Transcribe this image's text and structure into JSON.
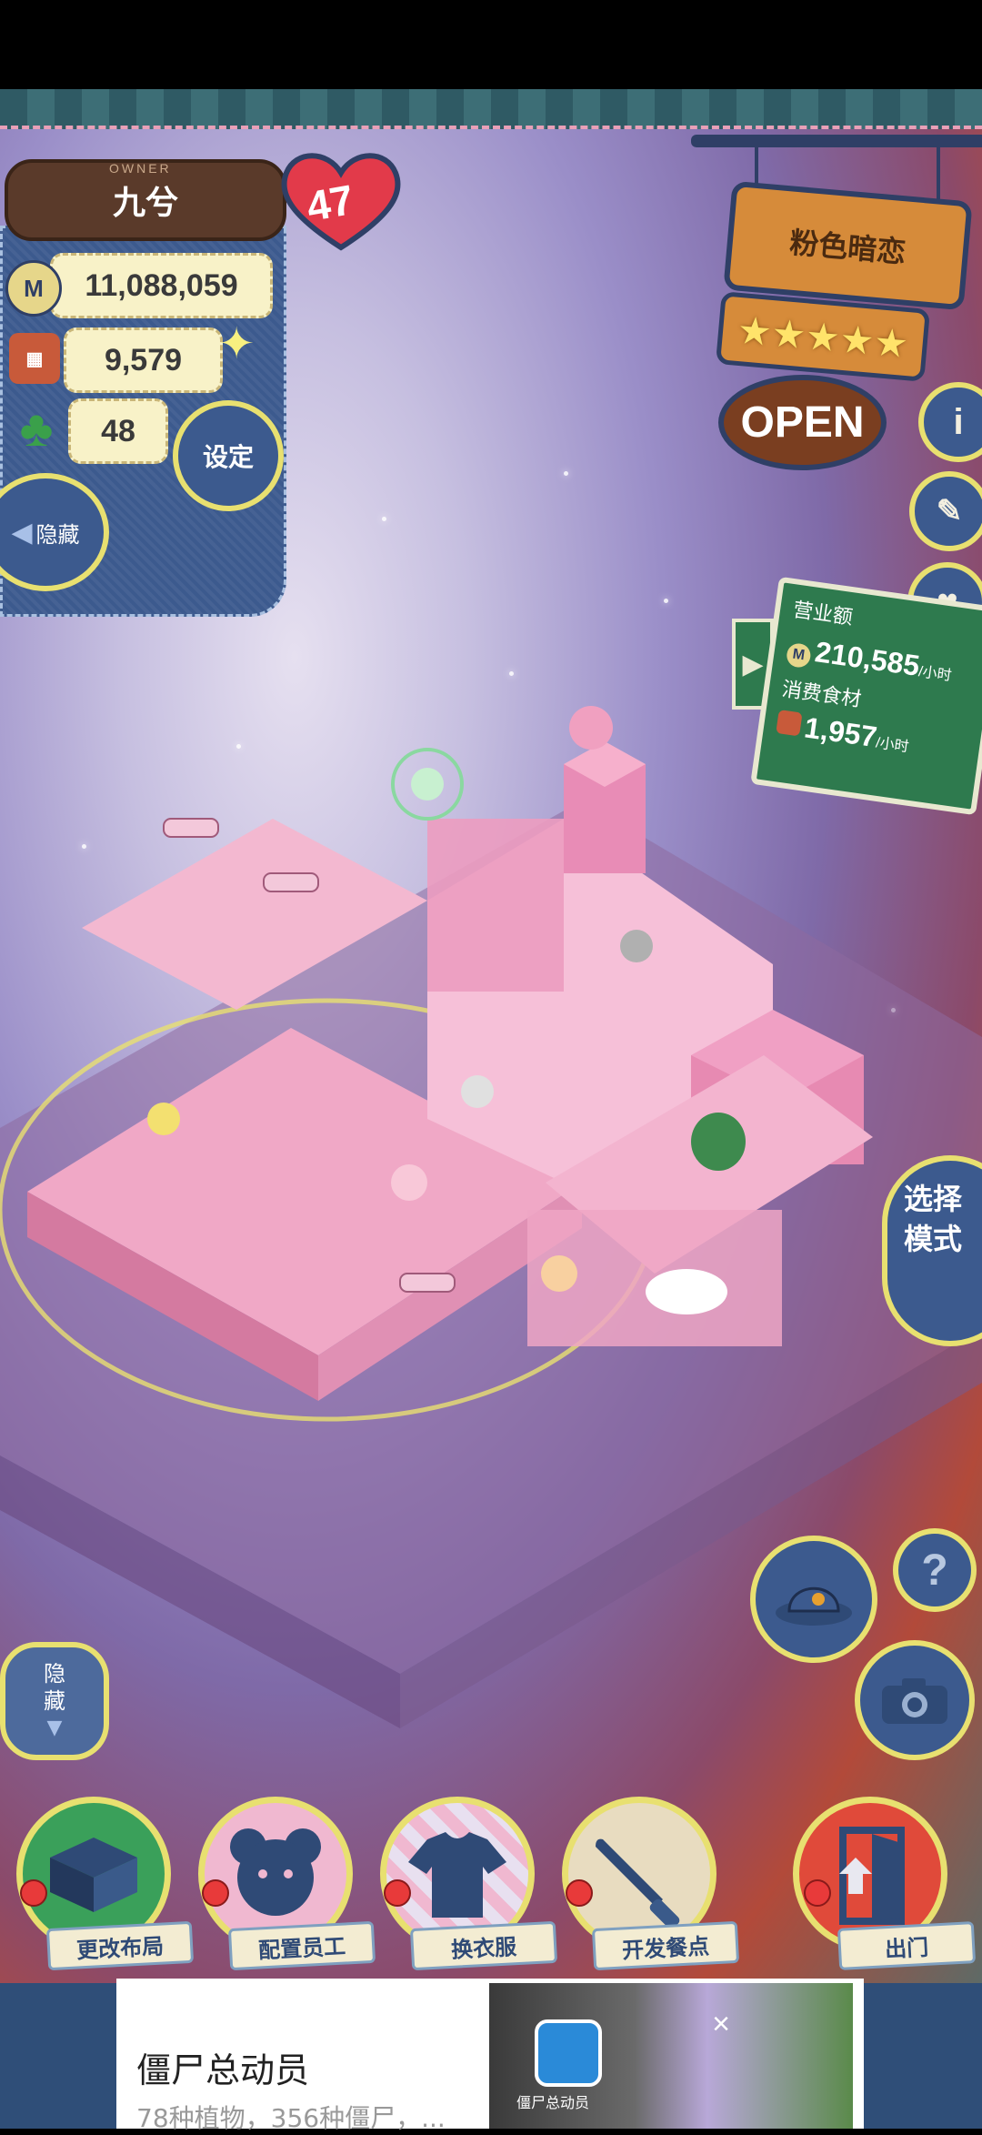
{
  "owner": {
    "tag": "OWNER",
    "name": "九兮",
    "level": "47"
  },
  "stats": {
    "coins": "11,088,059",
    "ingredients": "9,579",
    "clover": "48"
  },
  "icons": {
    "coin": "coin-icon",
    "basket": "basket-icon",
    "clover": "clover-icon",
    "sparkle": "sparkle-icon"
  },
  "buttons": {
    "settings": "设定",
    "hide_top": "隐藏",
    "hide_bottom_1": "隐",
    "hide_bottom_2": "藏",
    "mode_1": "选择",
    "mode_2": "模式"
  },
  "shop": {
    "name": "粉色暗恋",
    "stars": 5,
    "status": "OPEN"
  },
  "revenue": {
    "label": "营业额",
    "value": "210,585",
    "unit": "/小时",
    "food_label": "消费食材",
    "food_value": "1,957",
    "food_unit": "/小时"
  },
  "menu": [
    {
      "label": "更改布局",
      "icon": "table-icon"
    },
    {
      "label": "配置员工",
      "icon": "bear-icon"
    },
    {
      "label": "换衣服",
      "icon": "shirt-icon"
    },
    {
      "label": "开发餐点",
      "icon": "knife-icon"
    },
    {
      "label": "出门",
      "icon": "door-icon"
    }
  ],
  "ad": {
    "title": "僵尸总动员",
    "description": "78种植物，356种僵尸，...",
    "app_name": "僵尸总动员",
    "close": "×"
  },
  "colors": {
    "panel": "#3c5a8e",
    "ring": "#e8e070",
    "heart": "#e23a4a",
    "board_green": "#2e7a4e",
    "sign_orange": "#d68b3a"
  }
}
